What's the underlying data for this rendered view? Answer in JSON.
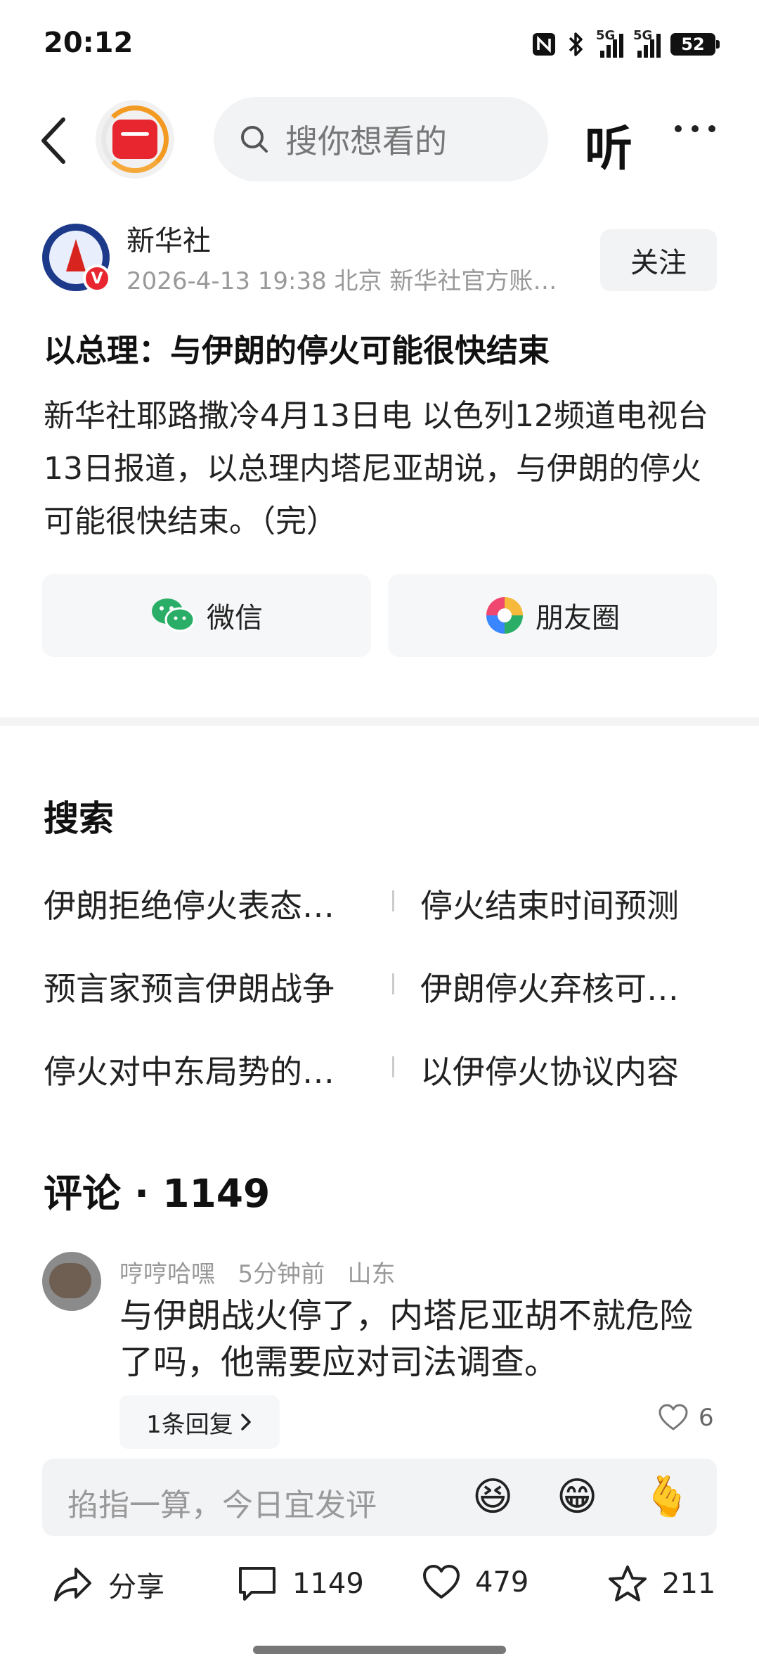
{
  "status_bar": {
    "time": "20:12",
    "battery": "52",
    "signal_label_1": "5G",
    "signal_label_2": "5G"
  },
  "nav": {
    "search_placeholder": "搜你想看的",
    "listen_label": "听"
  },
  "author": {
    "name": "新华社",
    "meta": "2026-4-13  19:38  北京  新华社官方账…",
    "follow_label": "关注",
    "badge": "V"
  },
  "article": {
    "title": "以总理：与伊朗的停火可能很快结束",
    "body": "新华社耶路撒冷4月13日电 以色列12频道电视台13日报道，以总理内塔尼亚胡说，与伊朗的停火可能很快结束。（完）"
  },
  "share": {
    "wechat_label": "微信",
    "moments_label": "朋友圈"
  },
  "search_section": {
    "title": "搜索",
    "keywords": [
      "伊朗拒绝停火表态…",
      "停火结束时间预测",
      "预言家预言伊朗战争",
      "伊朗停火弃核可…",
      "停火对中东局势的…",
      "以伊停火协议内容"
    ]
  },
  "comments": {
    "title": "评论 · 1149",
    "items": [
      {
        "user": "哼哼哈嘿",
        "time": "5分钟前",
        "location": "山东",
        "text": "与伊朗战火停了，内塔尼亚胡不就危险了吗，他需要应对司法调查。",
        "reply_label": "1条回复",
        "likes": "6"
      }
    ]
  },
  "input": {
    "placeholder": "掐指一算，今日宜发评",
    "emojis": [
      "😆",
      "😁",
      "🫰"
    ]
  },
  "actions": {
    "share_label": "分享",
    "comment_count": "1149",
    "like_count": "479",
    "favorite_count": "211"
  },
  "colors": {
    "accent_red": "#e8262f",
    "logo_orange": "#f39a22",
    "wechat_green": "#2aae67",
    "secondary_text": "#999999"
  }
}
